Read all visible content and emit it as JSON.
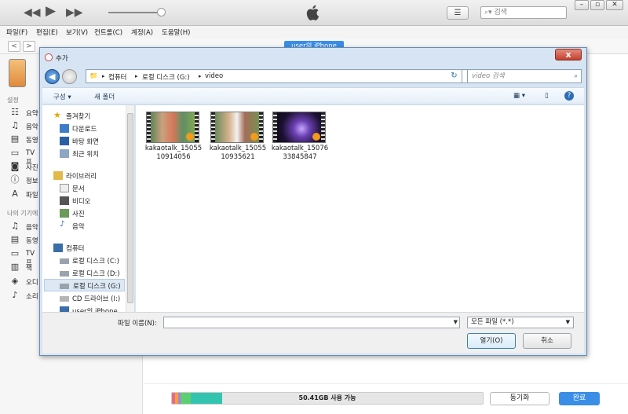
{
  "itunes": {
    "search_placeholder": "검색",
    "menu": [
      "파일(F)",
      "편집(E)",
      "보기(V)",
      "컨트롤(C)",
      "계정(A)",
      "도움말(H)"
    ],
    "device_tab": "user의 iPhone",
    "sidebar": {
      "settings_head": "설정",
      "settings_items": [
        {
          "label": "요약",
          "icon": "summary-icon"
        },
        {
          "label": "음악",
          "icon": "music-icon"
        },
        {
          "label": "동영",
          "icon": "movie-icon"
        },
        {
          "label": "TV 프",
          "icon": "tv-icon"
        },
        {
          "label": "사진",
          "icon": "camera-icon"
        },
        {
          "label": "정보",
          "icon": "info-icon"
        },
        {
          "label": "파일",
          "icon": "apps-icon"
        }
      ],
      "mydevice_head": "나의 기기에",
      "mydevice_items": [
        {
          "label": "음악",
          "icon": "music-icon"
        },
        {
          "label": "동영",
          "icon": "movie-icon"
        },
        {
          "label": "TV 프",
          "icon": "tv-icon"
        },
        {
          "label": "책",
          "icon": "book-icon"
        },
        {
          "label": "오디",
          "icon": "audiobook-icon"
        },
        {
          "label": "소리",
          "icon": "bell-icon"
        }
      ]
    },
    "storage": {
      "label": "50.41GB 사용 가능",
      "segments": [
        {
          "color": "#e66a8b",
          "fraction": 0.01
        },
        {
          "color": "#f0a23a",
          "fraction": 0.01
        },
        {
          "color": "#b57be0",
          "fraction": 0.008
        },
        {
          "color": "#5ccf73",
          "fraction": 0.032
        },
        {
          "color": "#33c4b0",
          "fraction": 0.1
        }
      ]
    },
    "sync_label": "동기화",
    "done_label": "완료",
    "accent_color": "#3a8ee6"
  },
  "dialog": {
    "title": "추가",
    "close_label": "x",
    "path": [
      "컴퓨터",
      "로컬 디스크 (G:)",
      "video"
    ],
    "search_placeholder": "video 검색",
    "toolbar": {
      "organize": "구성 ▾",
      "new_folder": "새 폴더"
    },
    "nav": [
      {
        "label": "즐겨찾기",
        "icon": "star-icon",
        "group": true
      },
      {
        "label": "다운로드",
        "icon": "download-folder-icon"
      },
      {
        "label": "바탕 화면",
        "icon": "desktop-icon"
      },
      {
        "label": "최근 위치",
        "icon": "recent-places-icon"
      },
      {
        "label": "라이브러리",
        "icon": "library-icon",
        "group": true
      },
      {
        "label": "문서",
        "icon": "documents-icon"
      },
      {
        "label": "비디오",
        "icon": "videos-icon"
      },
      {
        "label": "사진",
        "icon": "pictures-icon"
      },
      {
        "label": "음악",
        "icon": "music-library-icon"
      },
      {
        "label": "컴퓨터",
        "icon": "computer-icon",
        "group": true
      },
      {
        "label": "로컬 디스크 (C:)",
        "icon": "drive-icon"
      },
      {
        "label": "로컬 디스크 (D:)",
        "icon": "drive-icon"
      },
      {
        "label": "로컬 디스크 (G:)",
        "icon": "drive-icon",
        "selected": true
      },
      {
        "label": "CD 드라이브 (I:)",
        "icon": "cd-drive-icon"
      },
      {
        "label": "user의 iPhone",
        "icon": "iphone-icon"
      }
    ],
    "files": [
      {
        "line1": "kakaotalk_15055",
        "line2": "10914056"
      },
      {
        "line1": "kakaotalk_15055",
        "line2": "10935621"
      },
      {
        "line1": "kakaotalk_15076",
        "line2": "33845847"
      }
    ],
    "filename_label": "파일 이름(N):",
    "filename_value": "",
    "filetype": "모든 파일 (*.*)",
    "open_label": "열기(O)",
    "cancel_label": "취소"
  }
}
